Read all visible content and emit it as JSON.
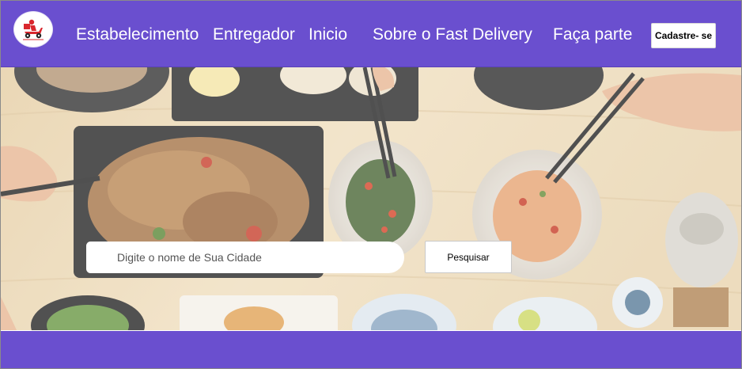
{
  "navbar": {
    "logo_icon": "delivery-scooter-icon",
    "links": [
      {
        "label": "Estabelecimento"
      },
      {
        "label": "Entregador"
      },
      {
        "label": "Inicio"
      },
      {
        "label": "Sobre o Fast Delivery"
      },
      {
        "label": "Faça parte"
      }
    ],
    "signup_label": "Cadastre- se"
  },
  "search": {
    "placeholder": "Digite o nome de Sua Cidade",
    "button_label": "Pesquisar"
  },
  "colors": {
    "brand": "#6a4fcf",
    "logo_red": "#d9272e"
  }
}
